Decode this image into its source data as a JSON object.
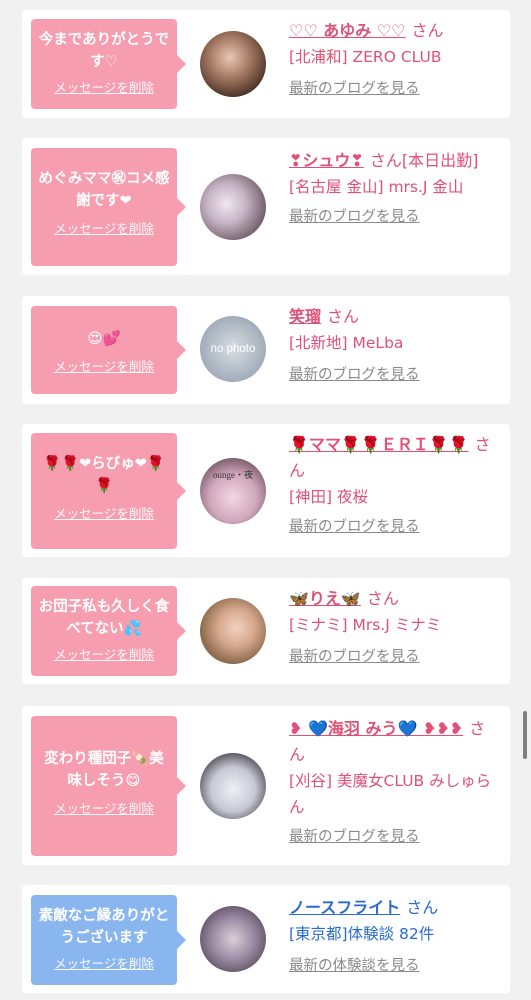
{
  "cards": [
    {
      "message": "今までありがとうです♡",
      "delete": "メッセージを削除",
      "name": "♡♡ あゆみ ♡♡",
      "san": "さん",
      "shop": "[北浦和] ZERO CLUB",
      "link": "最新のブログを見る"
    },
    {
      "message": "めぐみママ㊗コメ感謝です❤",
      "delete": "メッセージを削除",
      "name": "❣シュウ❣",
      "san": "さん[本日出勤]",
      "shop": "[名古屋 金山] mrs.J 金山",
      "link": "最新のブログを見る"
    },
    {
      "message": "😍💕",
      "delete": "メッセージを削除",
      "name": "笑瑠",
      "san": "さん",
      "shop": "[北新地] MeLba",
      "link": "最新のブログを見る",
      "avatar_text": "no photo"
    },
    {
      "message": "🌹🌹❤らびゅ❤🌹🌹",
      "delete": "メッセージを削除",
      "name": "🌹ママ🌹🌹ＥＲＩ🌹🌹",
      "san": "さん",
      "shop": "[神田] 夜桜",
      "link": "最新のブログを見る",
      "avatar_text": "ounge・夜"
    },
    {
      "message": "お団子私も久しく食べてない💦",
      "delete": "メッセージを削除",
      "name": "🦋りえ🦋",
      "san": "さん",
      "shop": "[ミナミ] Mrs.J ミナミ",
      "link": "最新のブログを見る"
    },
    {
      "message": "変わり種団子🍡美味しそう😋",
      "delete": "メッセージを削除",
      "name": "❥ 💙海羽 みう💙 ❥❥❥",
      "san": "さん",
      "shop": "[刈谷] 美魔女CLUB みしゅらん",
      "link": "最新のブログを見る"
    },
    {
      "message": "素敵なご縁ありがとうございます",
      "delete": "メッセージを削除",
      "name": "ノースフライト",
      "san": "さん",
      "shop": "[東京都]体験談 82件",
      "link": "最新の体験談を見る"
    }
  ],
  "colors": {
    "pink_bubble": "#f79db0",
    "blue_bubble": "#8ab6f0",
    "pink_text": "#e05077",
    "blue_text": "#2a6bd1"
  }
}
